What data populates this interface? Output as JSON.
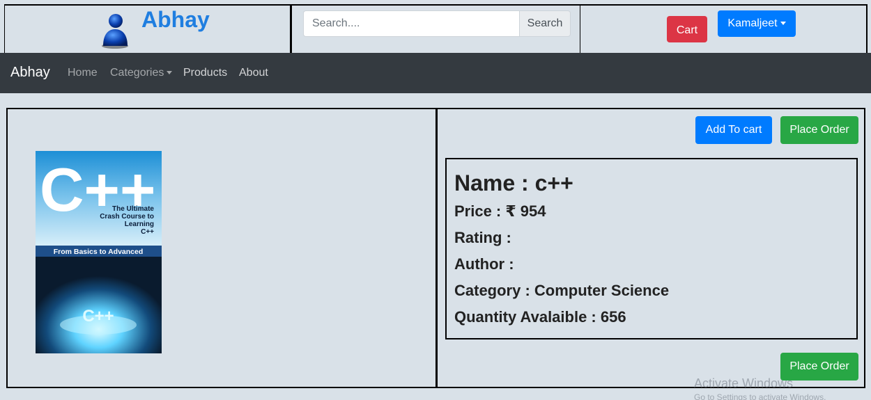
{
  "header": {
    "brand": "Abhay",
    "search": {
      "placeholder": "Search....",
      "button": "Search"
    },
    "cart": "Cart",
    "user": "Kamaljeet"
  },
  "nav": {
    "brand": "Abhay",
    "links": [
      "Home",
      "Categories",
      "Products",
      "About"
    ]
  },
  "product": {
    "add_to_cart": "Add To cart",
    "place_order": "Place Order",
    "name": "Name : c++",
    "price": "Price : ₹ 954",
    "rating": "Rating :",
    "author": "Author :",
    "category": "Category : Computer Science",
    "quantity": "Quantity Avalaible : 656",
    "book_cover": {
      "title": "C++",
      "subtitle": "The Ultimate Crash Course to Learning C++",
      "band": "From Basics to Advanced",
      "inner": "C++"
    }
  },
  "watermark": {
    "line1": "Activate Windows",
    "line2": "Go to Settings to activate Windows."
  },
  "colors": {
    "page_bg": "#d9e1e8",
    "navbar_bg": "#343a40",
    "brand_blue": "#1f7ee0",
    "primary": "#007bff",
    "danger": "#dc3545",
    "success": "#28a745"
  }
}
